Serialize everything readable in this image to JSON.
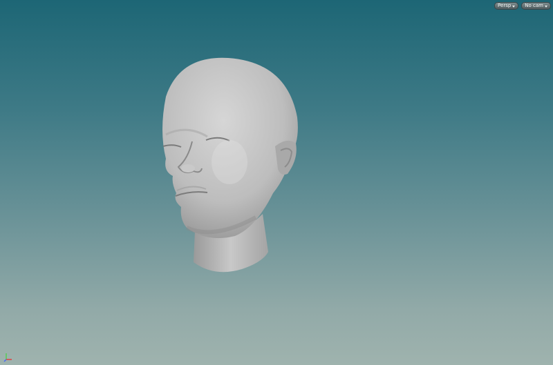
{
  "viewport": {
    "camera_menu": {
      "label": "Persp",
      "icon": "chevron-down-icon"
    },
    "view_menu": {
      "label": "No cam",
      "icon": "chevron-down-icon"
    },
    "model": "head-mesh",
    "gizmo": "axis-gizmo-icon",
    "colors": {
      "background_top": "#1d6675",
      "background_bottom": "#9fb3ae",
      "mesh": "#bcbcbc"
    }
  }
}
